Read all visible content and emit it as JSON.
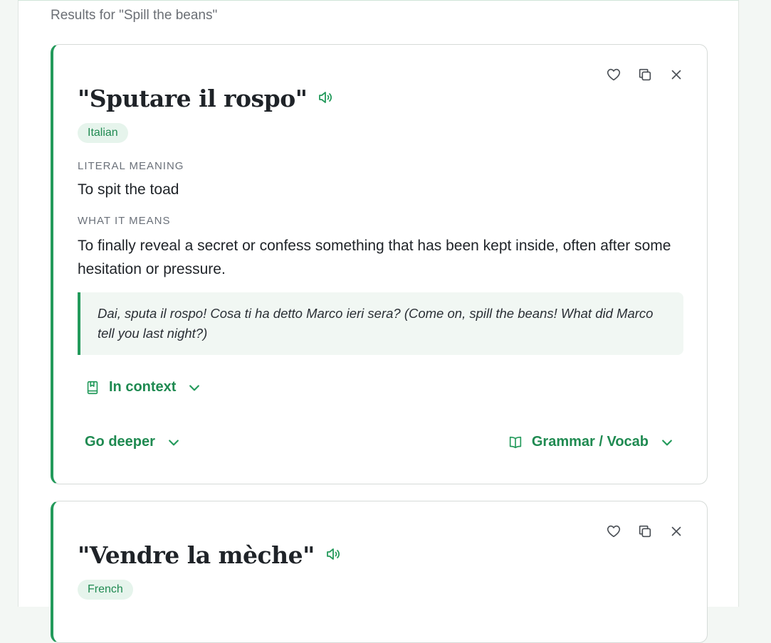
{
  "results_heading": "Results for \"Spill the beans\"",
  "accent_color": "#239a5b",
  "cards": [
    {
      "idiom": "\"Sputare il rospo\"",
      "language": "Italian",
      "literal_label": "LITERAL MEANING",
      "literal": "To spit the toad",
      "means_label": "WHAT IT MEANS",
      "meaning": "To finally reveal a secret or confess something that has been kept inside, often after some hesitation or pressure.",
      "example": "Dai, sputa il rospo! Cosa ti ha detto Marco ieri sera? (Come on, spill the beans! What did Marco tell you last night?)",
      "in_context_label": "In context",
      "go_deeper_label": "Go deeper",
      "grammar_label": "Grammar / Vocab"
    },
    {
      "idiom": "\"Vendre la mèche\"",
      "language": "French"
    }
  ],
  "icons": [
    "heart-icon",
    "copy-icon",
    "close-icon",
    "speaker-icon",
    "bookmark-book-icon",
    "open-book-icon",
    "chevron-down-icon"
  ]
}
